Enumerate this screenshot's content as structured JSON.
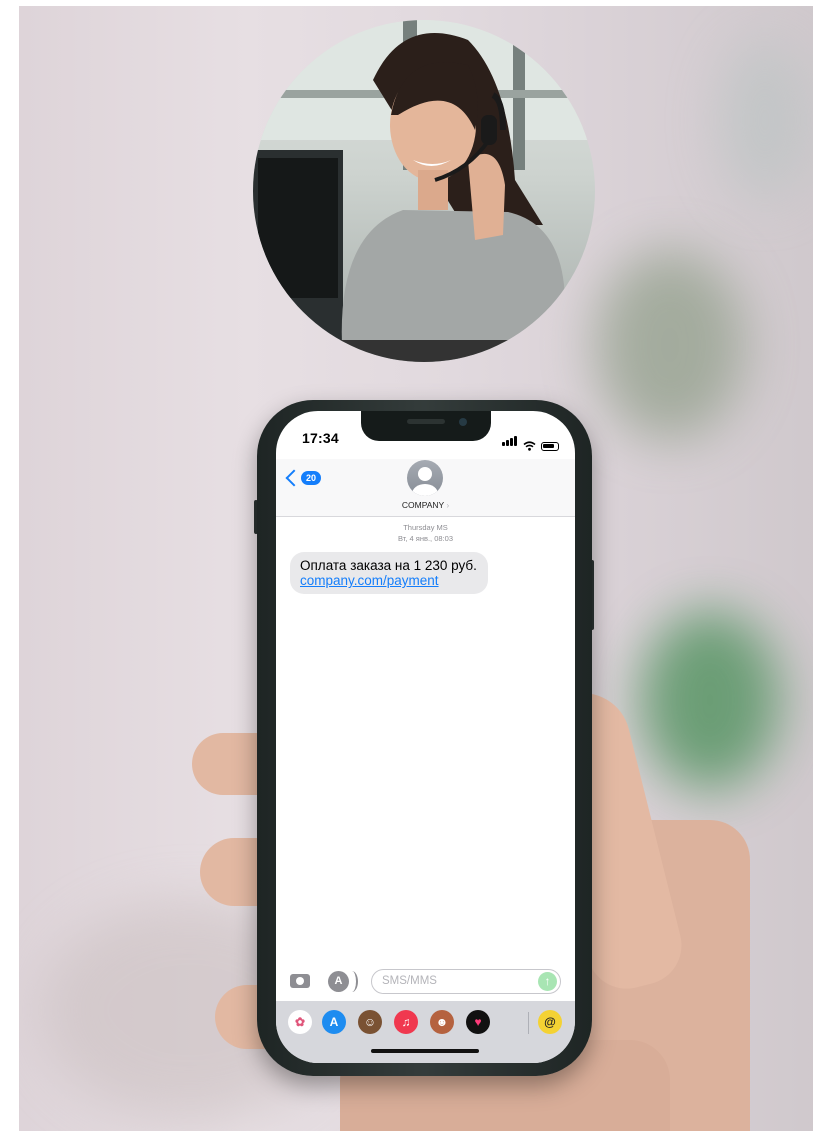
{
  "status_bar": {
    "time": "17:34"
  },
  "header": {
    "back_count": "20",
    "contact_name": "COMPANY"
  },
  "conversation": {
    "label": "Thursday",
    "service": "MS",
    "date_time": "Вт, 4 янв., 08:03",
    "message": {
      "text": "Оплата заказа на 1 230 руб.",
      "link": "company.com/payment"
    }
  },
  "compose": {
    "placeholder": "SMS/MMS"
  },
  "app_tray": {
    "icons": [
      "photos-icon",
      "app-store-icon",
      "memoji-icon",
      "music-icon",
      "animoji-icon",
      "digital-touch-icon",
      "gif-icon"
    ]
  },
  "colors": {
    "imessage_blue": "#147efb",
    "bubble_gray": "#e9e9eb",
    "send_green": "#a8e5b3"
  }
}
